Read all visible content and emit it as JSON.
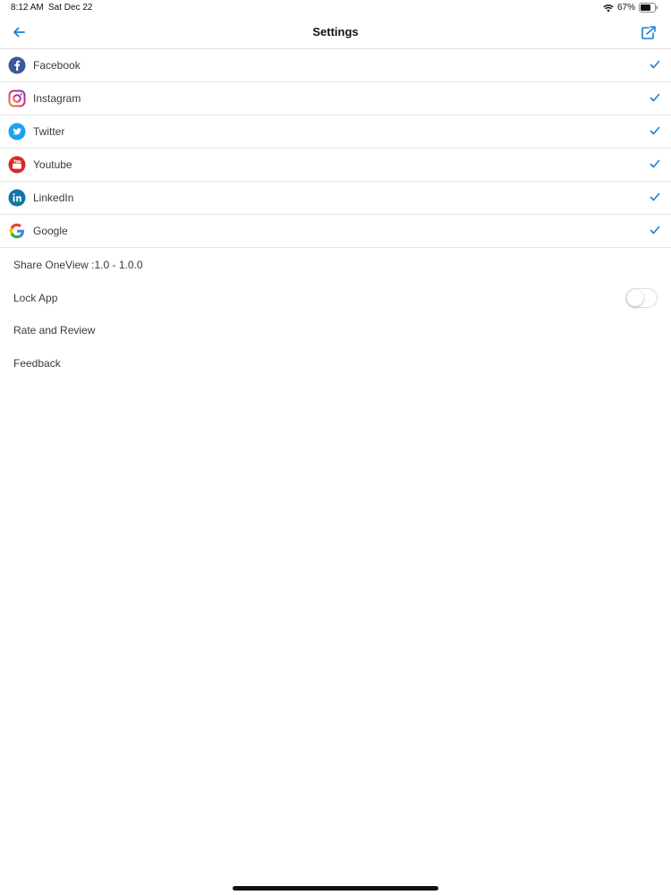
{
  "status_bar": {
    "time": "8:12 AM",
    "date": "Sat Dec 22",
    "battery": "67%"
  },
  "nav": {
    "title": "Settings",
    "back_icon": "arrow-left-icon",
    "share_icon": "share-icon"
  },
  "colors": {
    "accent": "#1a7fd4",
    "facebook": "#3b5998",
    "twitter": "#1da1f2",
    "youtube": "#d62b23",
    "linkedin": "#0e76a8",
    "instagram": "#c13584"
  },
  "accounts": [
    {
      "label": "Facebook",
      "icon": "facebook-icon",
      "checked": true
    },
    {
      "label": "Instagram",
      "icon": "instagram-icon",
      "checked": true
    },
    {
      "label": "Twitter",
      "icon": "twitter-icon",
      "checked": true
    },
    {
      "label": "Youtube",
      "icon": "youtube-icon",
      "checked": true
    },
    {
      "label": "LinkedIn",
      "icon": "linkedin-icon",
      "checked": true
    },
    {
      "label": "Google",
      "icon": "google-icon",
      "checked": true
    }
  ],
  "options": {
    "share": "Share OneView :1.0 - 1.0.0",
    "lock_app": "Lock App",
    "lock_app_enabled": false,
    "rate": "Rate and Review",
    "feedback": "Feedback"
  }
}
